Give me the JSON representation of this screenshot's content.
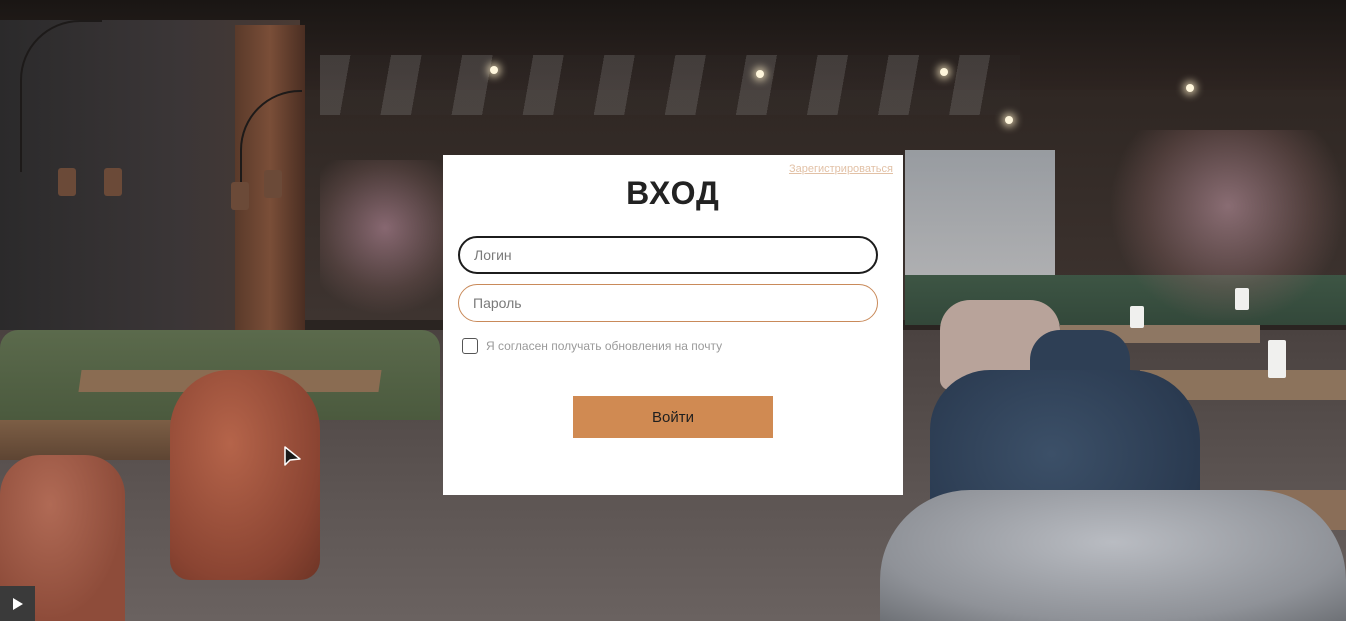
{
  "login": {
    "title": "ВХОД",
    "register_link": "Зарегистрироваться",
    "login_placeholder": "Логин",
    "password_placeholder": "Пароль",
    "consent_label": "Я согласен получать обновления на почту",
    "consent_checked": false,
    "submit_label": "Войти"
  },
  "colors": {
    "accent": "#d08a52",
    "register_link": "#e2c1a6",
    "card_background": "#ffffff"
  },
  "icons": {
    "cursor": "cursor-icon",
    "play": "play-icon"
  }
}
